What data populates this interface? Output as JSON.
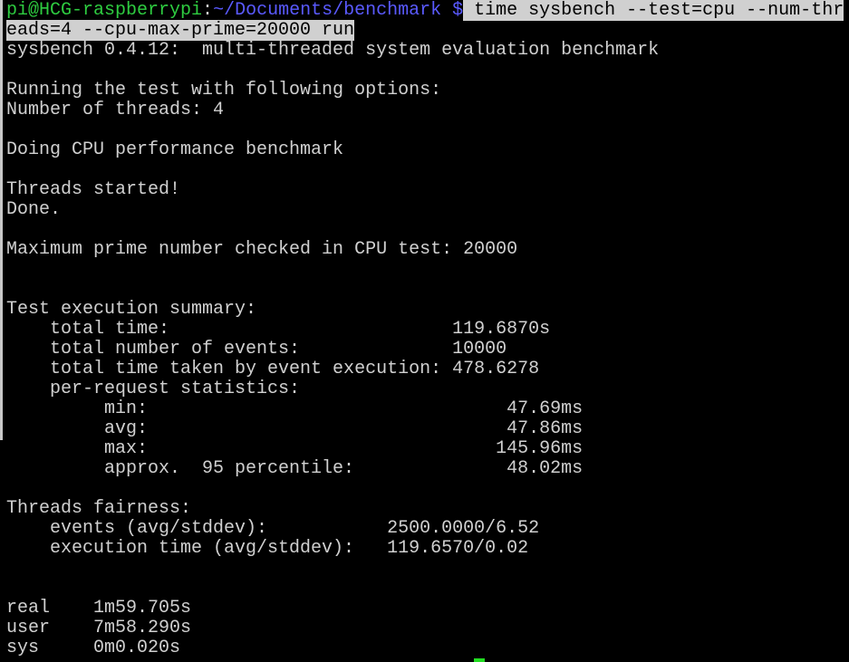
{
  "prompt": {
    "user_host": "pi@HCG-raspberrypi",
    "separator": ":",
    "path": "~/Documents/benchmark",
    "symbol": " $",
    "command_part1": " time sysbench --test=cpu --num-thr",
    "command_part2": "eads=4 --cpu-max-prime=20000 run"
  },
  "output": {
    "banner": "sysbench 0.4.12:  multi-threaded system evaluation benchmark",
    "running_options": "Running the test with following options:",
    "num_threads": "Number of threads: 4",
    "doing_cpu": "Doing CPU performance benchmark",
    "threads_started": "Threads started!",
    "done": "Done.",
    "max_prime": "Maximum prime number checked in CPU test: 20000",
    "summary_header": "Test execution summary:",
    "total_time": "    total time:                          119.6870s",
    "total_events": "    total number of events:              10000",
    "total_event_exec": "    total time taken by event execution: 478.6278",
    "per_request": "    per-request statistics:",
    "min": "         min:                                 47.69ms",
    "avg": "         avg:                                 47.86ms",
    "max": "         max:                                145.96ms",
    "approx95": "         approx.  95 percentile:              48.02ms",
    "fairness_header": "Threads fairness:",
    "events_avg": "    events (avg/stddev):           2500.0000/6.52",
    "exec_time_avg": "    execution time (avg/stddev):   119.6570/0.02",
    "real": "real    1m59.705s",
    "user": "user    7m58.290s",
    "sys": "sys     0m0.020s"
  },
  "colors": {
    "background": "#000000",
    "text": "#d0d0d0",
    "prompt_user": "#2ecc40",
    "prompt_path": "#5a5aff",
    "selection_bg": "#d0d0d0",
    "cursor": "#22dd22"
  }
}
